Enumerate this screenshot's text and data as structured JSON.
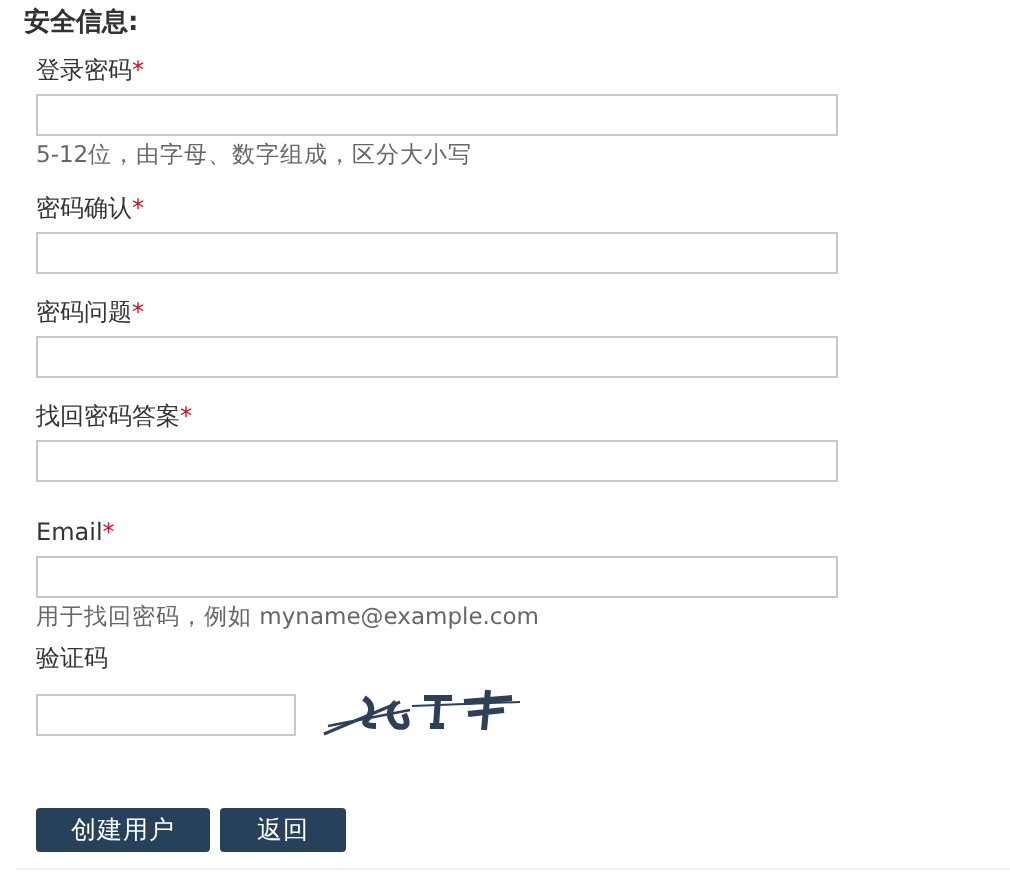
{
  "section_title": "安全信息:",
  "required_mark": "*",
  "fields": [
    {
      "kind": "text",
      "label": "登录密码",
      "required": true,
      "hint": "5-12位，由字母、数字组成，区分大小写"
    },
    {
      "kind": "text",
      "label": "密码确认",
      "required": true
    },
    {
      "kind": "text",
      "label": "密码问题",
      "required": true
    },
    {
      "kind": "text",
      "label": "找回密码答案",
      "required": true
    },
    {
      "kind": "text",
      "label": "Email",
      "required": true,
      "hint": "用于找回密码，例如 myname@example.com"
    },
    {
      "kind": "captcha",
      "label": "验证码",
      "required": false
    }
  ],
  "buttons": [
    "创建用户",
    "返回"
  ]
}
